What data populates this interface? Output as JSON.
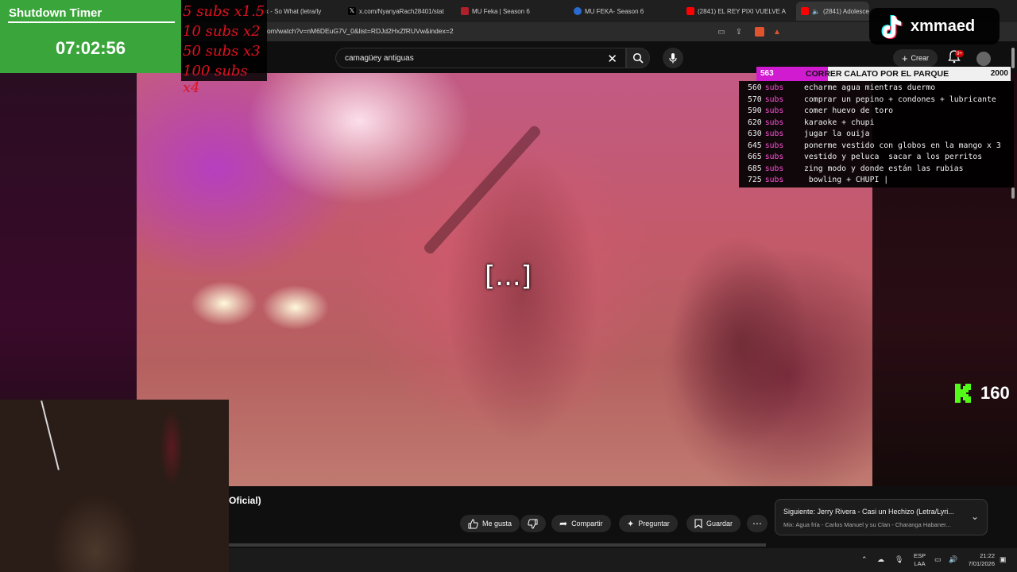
{
  "browser": {
    "tabs": [
      {
        "label": "P!nk - So What (letra/ly",
        "favicon_color": "#333333"
      },
      {
        "label": "x.com/NyanyaRach28401/stat",
        "favicon_color": "#000000"
      },
      {
        "label": "MU Feka | Season 6",
        "favicon_color": "#b0202a"
      },
      {
        "label": "MU FEKA- Season 6",
        "favicon_color": "#2a6bd1"
      },
      {
        "label": "(2841) EL REY PIXI VUELVE A L",
        "favicon_color": "#ff0000"
      },
      {
        "label": "(2841) Adolescen",
        "favicon_color": "#ff0000",
        "active": true
      }
    ],
    "url": "om/watch?v=nM6DEuG7V_0&list=RDJd2HxZfRUVw&index=2"
  },
  "youtube": {
    "search_query": "camagüey antiguas",
    "create_label": "Crear",
    "notif_count": "9+",
    "video_caption": "[...]",
    "title_fragment": "Oficial)",
    "actions": {
      "like": "Me gusta",
      "share": "Compartir",
      "ask": "Preguntar",
      "save": "Guardar"
    },
    "up_next": {
      "line1": "Siguiente: Jerry Rivera - Casi un Hechizo (Letra/Lyri...",
      "line2": "Mix: Agua fría - Carlos Manuel y su Clan - Charanga Habaner..."
    }
  },
  "overlays": {
    "timer": {
      "title": "Shutdown Timer",
      "value": "07:02:56"
    },
    "multipliers": [
      "5 subs x1.5",
      "10 subs x2",
      "50 subs x3",
      "100 subs x4"
    ],
    "tiktok_name": "xmmaed",
    "goal": {
      "current": "563",
      "label": "CORRER CALATO POR EL PARQUE",
      "target": "2000",
      "progress": 0.28
    },
    "sub_goals": [
      {
        "count": "560",
        "unit": "subs",
        "text": "echarme agua mientras duermo"
      },
      {
        "count": "570",
        "unit": "subs",
        "text": "comprar un pepino + condones + lubricante"
      },
      {
        "count": "590",
        "unit": "subs",
        "text": "comer huevo de toro"
      },
      {
        "count": "620",
        "unit": "subs",
        "text": "karaoke + chupi"
      },
      {
        "count": "630",
        "unit": "subs",
        "text": "jugar la ouija"
      },
      {
        "count": "645",
        "unit": "subs",
        "text": "ponerme vestido con globos en la mango x 3"
      },
      {
        "count": "665",
        "unit": "subs",
        "text": "vestido y peluca  sacar a los perritos"
      },
      {
        "count": "685",
        "unit": "subs",
        "text": "zing modo y donde están las rubias"
      },
      {
        "count": "725",
        "unit": "subs",
        "text": " bowling + CHUPI |"
      }
    ],
    "kick_count": "160"
  },
  "taskbar": {
    "lang": "ESP",
    "lang2": "LAA",
    "time": "21:22",
    "date": "7/01/2026"
  },
  "colors": {
    "timer_bg": "#3aa53a",
    "multiplier_text": "#e01020",
    "goal_fill": "#d11bd1",
    "kick_green": "#53fc18"
  }
}
